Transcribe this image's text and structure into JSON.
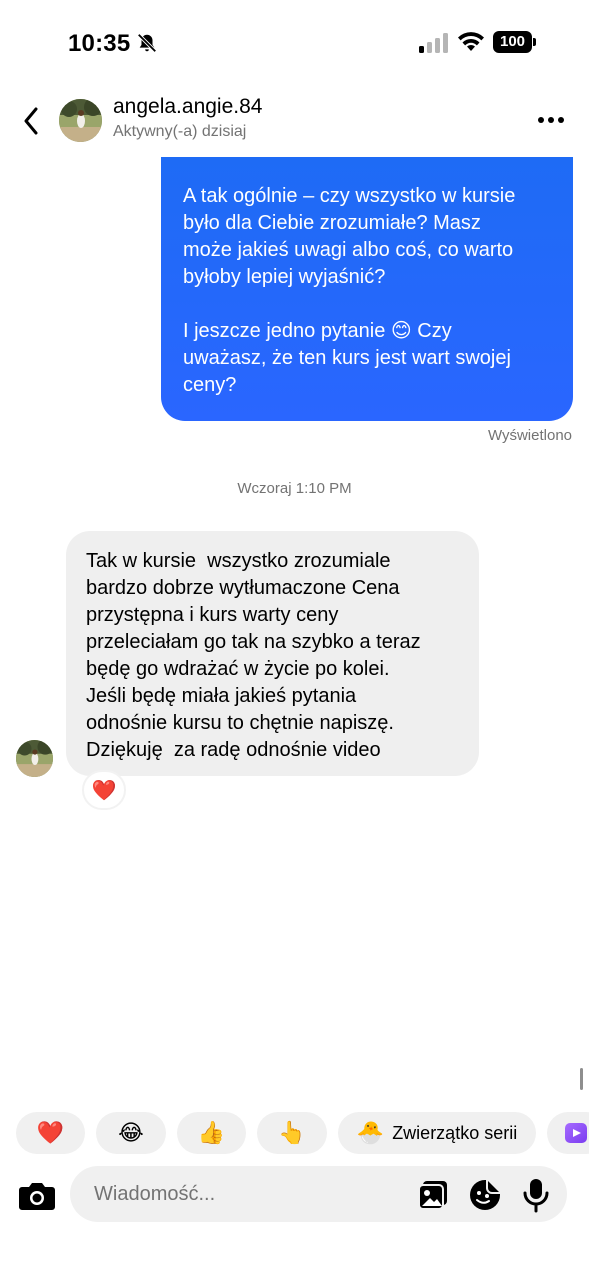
{
  "status_bar": {
    "time": "10:35",
    "battery": "100",
    "icons": [
      "bell-off-icon",
      "signal-icon",
      "wifi-icon",
      "battery-icon"
    ]
  },
  "header": {
    "back_icon": "chevron-left-icon",
    "contact_name": "angela.angie.84",
    "contact_status": "Aktywny(-a) dzisiaj",
    "more_icon": "more-horizontal-icon"
  },
  "messages": {
    "sent": {
      "text": "A tak ogólnie – czy wszystko w kursie\nbyło dla Ciebie zrozumiałe? Masz\nmoże jakieś uwagi albo coś, co warto\nbyłoby lepiej wyjaśnić?\n\nI jeszcze jedno pytanie 😊 Czy\nuważasz, że ten kurs jest wart swojej\nceny?",
      "seen_label": "Wyświetlono"
    },
    "timestamp": "Wczoraj 1:10 PM",
    "received": {
      "text": "Tak w kursie  wszystko zrozumiale\nbardzo dobrze wytłumaczone Cena\nprzystępna i kurs warty ceny\nprzeleciałam go tak na szybko a teraz\nbędę go wdrażać w życie po kolei.\nJeśli będę miała jakieś pytania\nodnośnie kursu to chętnie napiszę.\nDziękuję  za radę odnośnie video",
      "reaction": "❤️"
    }
  },
  "quick_replies": [
    {
      "emoji": "❤️"
    },
    {
      "emoji": "😂"
    },
    {
      "emoji": "👍"
    },
    {
      "emoji": "👆"
    },
    {
      "emoji": "🐣",
      "label": "Zwierzątko serii"
    }
  ],
  "composer": {
    "placeholder": "Wiadomość...",
    "icons": [
      "camera-icon",
      "gallery-icon",
      "sticker-icon",
      "microphone-icon"
    ]
  },
  "colors": {
    "sent_bubble": "#2a66ff",
    "received_bubble": "#efefef",
    "secondary_text": "#737373"
  }
}
